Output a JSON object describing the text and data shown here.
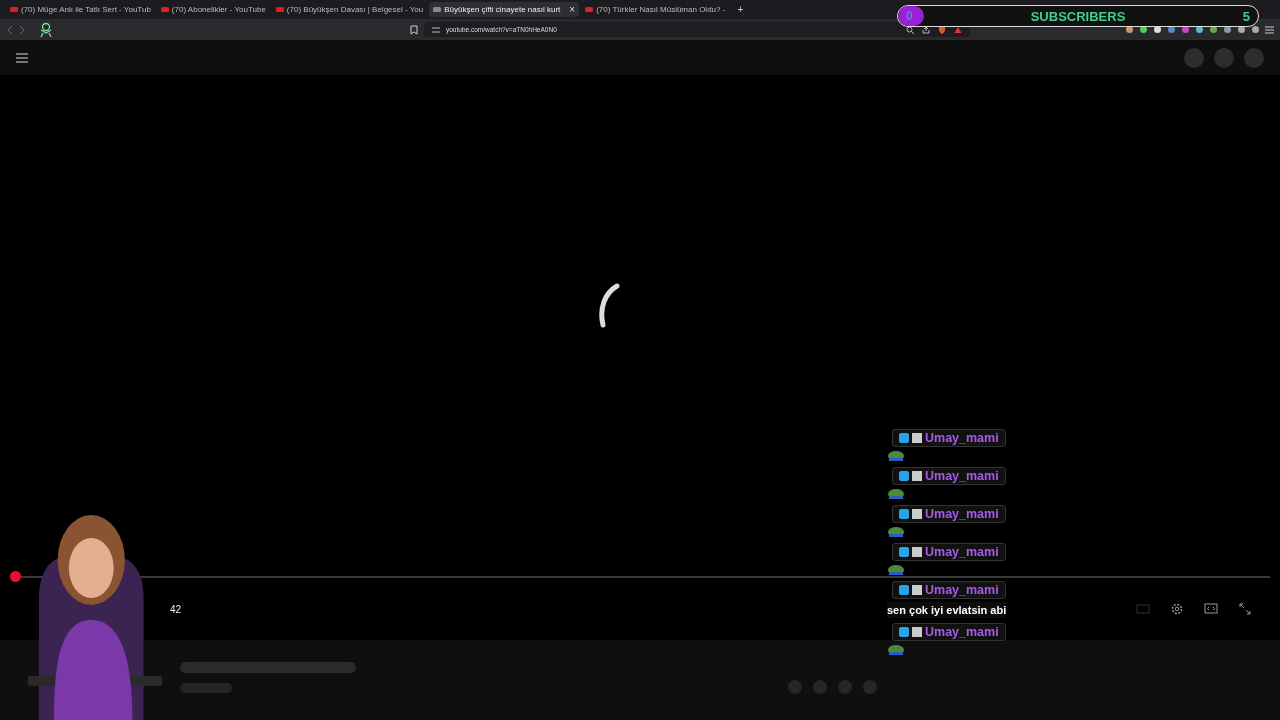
{
  "browser": {
    "tabs": [
      {
        "title": "(70) Müge Anlı ile Tatlı Sert - YouTub",
        "selected": false
      },
      {
        "title": "(70) Abonelikler - YouTube",
        "selected": false
      },
      {
        "title": "(70) Büyükşen Davası | Belgesel - You",
        "selected": false
      },
      {
        "title": "Büyükşen çifti cinayete nasıl kurt",
        "selected": true
      },
      {
        "title": "(70) Türkler Nasıl Müslüman Oldu? -",
        "selected": false
      }
    ],
    "tab_close": "×",
    "new_tab": "+",
    "address": "youtube.com/watch?v=aTN0hHeA0N0"
  },
  "player": {
    "time": "42"
  },
  "subscriber_goal": {
    "current": "0",
    "label": "SUBSCRIBERS",
    "goal": "5",
    "level": 0
  },
  "chat": [
    {
      "user": "Umay_mami",
      "kind": "emote"
    },
    {
      "user": "Umay_mami",
      "kind": "emote"
    },
    {
      "user": "Umay_mami",
      "kind": "emote"
    },
    {
      "user": "Umay_mami",
      "kind": "emote"
    },
    {
      "user": "Umay_mami",
      "kind": "text",
      "text": "sen çok iyi evlatsin abi"
    },
    {
      "user": "Umay_mami",
      "kind": "emote"
    }
  ]
}
